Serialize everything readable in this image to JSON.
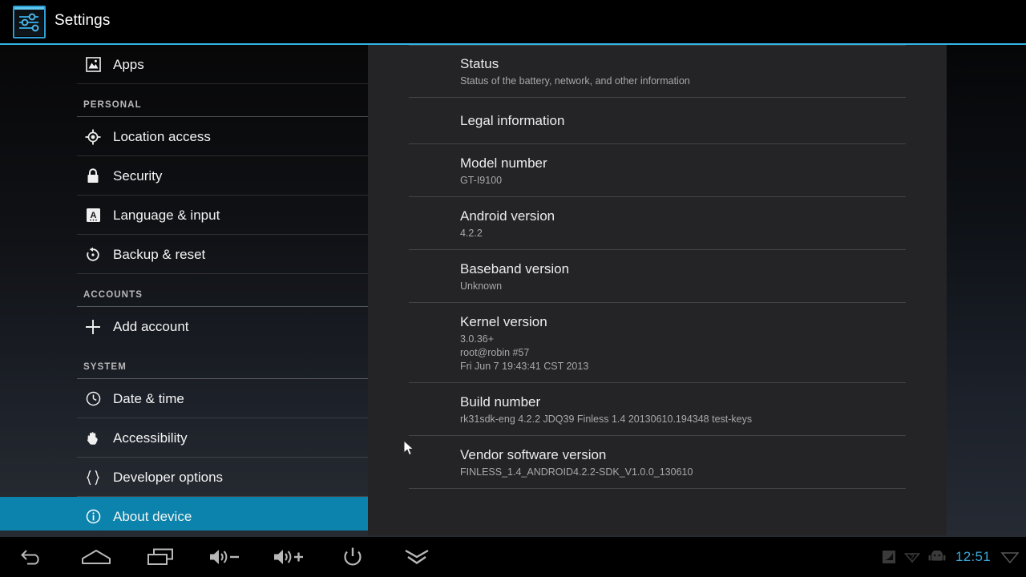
{
  "titlebar": {
    "app_icon": "settings-sliders-icon",
    "title": "Settings",
    "accent_color": "#33b5e5"
  },
  "sidebar": {
    "accent_color": "#0c83ac",
    "rows": [
      {
        "type": "item",
        "icon": "apps-picture-icon",
        "label": "Apps",
        "selected": false
      },
      {
        "type": "header",
        "label": "PERSONAL"
      },
      {
        "type": "item",
        "icon": "location-target-icon",
        "label": "Location access",
        "selected": false
      },
      {
        "type": "item",
        "icon": "lock-icon",
        "label": "Security",
        "selected": false
      },
      {
        "type": "item",
        "icon": "language-a-icon",
        "label": "Language & input",
        "selected": false
      },
      {
        "type": "item",
        "icon": "backup-restore-icon",
        "label": "Backup & reset",
        "selected": false
      },
      {
        "type": "header",
        "label": "ACCOUNTS"
      },
      {
        "type": "item",
        "icon": "plus-icon",
        "label": "Add account",
        "selected": false
      },
      {
        "type": "header",
        "label": "SYSTEM"
      },
      {
        "type": "item",
        "icon": "clock-icon",
        "label": "Date & time",
        "selected": false
      },
      {
        "type": "item",
        "icon": "hand-icon",
        "label": "Accessibility",
        "selected": false
      },
      {
        "type": "item",
        "icon": "braces-icon",
        "label": "Developer options",
        "selected": false
      },
      {
        "type": "item",
        "icon": "info-circle-icon",
        "label": "About device",
        "selected": true
      }
    ]
  },
  "content": {
    "prefs": [
      {
        "title": "Status",
        "summary": "Status of the battery, network, and other information"
      },
      {
        "title": "Legal information",
        "summary": ""
      },
      {
        "title": "Model number",
        "summary": "GT-I9100"
      },
      {
        "title": "Android version",
        "summary": "4.2.2"
      },
      {
        "title": "Baseband version",
        "summary": "Unknown"
      },
      {
        "title": "Kernel version",
        "summary": "3.0.36+\nroot@robin #57\nFri Jun 7 19:43:41 CST 2013"
      },
      {
        "title": "Build number",
        "summary": "rk31sdk-eng 4.2.2 JDQ39 Finless 1.4 20130610.194348 test-keys"
      },
      {
        "title": "Vendor software version",
        "summary": "FINLESS_1.4_ANDROID4.2.2-SDK_V1.0.0_130610"
      }
    ]
  },
  "systembar": {
    "buttons": [
      {
        "icon": "back-icon",
        "label": "Back"
      },
      {
        "icon": "home-icon",
        "label": "Home"
      },
      {
        "icon": "recents-icon",
        "label": "Recent apps"
      },
      {
        "icon": "volume-down-icon",
        "label": "Volume down"
      },
      {
        "icon": "volume-up-icon",
        "label": "Volume up"
      },
      {
        "icon": "power-icon",
        "label": "Power"
      },
      {
        "icon": "chevrons-down-icon",
        "label": "Hide navigation bar"
      }
    ],
    "status_icons": [
      {
        "icon": "sdcard-icon"
      },
      {
        "icon": "unknown-question-icon"
      },
      {
        "icon": "android-robot-icon"
      }
    ],
    "clock": "12:51",
    "clock_color": "#3aa8d8",
    "wifi_icon": "wifi-empty-icon"
  }
}
